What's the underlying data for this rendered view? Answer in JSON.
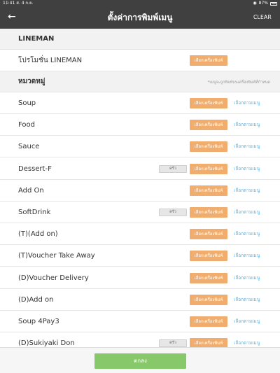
{
  "status_bar": {
    "time": "11:41",
    "date": "ส. 4 ก.ย.",
    "battery": "87%"
  },
  "nav": {
    "title": "ตั้งค่าการพิมพ์เมนู",
    "clear_label": "CLEAR"
  },
  "lineman_section": {
    "title": "LINEMAN",
    "item": {
      "label": "โปรโมชั่น LINEMAN",
      "printer_button": "เลือกเครื่องพิมพ์"
    }
  },
  "category_section": {
    "title": "หมวดหมู่",
    "note": "*เมนูจะถูกพิมพ์บนเครื่องพิมพ์ที่กำหนด"
  },
  "categories": [
    {
      "label": "Soup",
      "badge": "",
      "printer_button": "เลือกเครื่องพิมพ์",
      "menu_button": "เลือกตามเมนู"
    },
    {
      "label": "Food",
      "badge": "",
      "printer_button": "เลือกเครื่องพิมพ์",
      "menu_button": "เลือกตามเมนู"
    },
    {
      "label": "Sauce",
      "badge": "",
      "printer_button": "เลือกเครื่องพิมพ์",
      "menu_button": "เลือกตามเมนู"
    },
    {
      "label": "Dessert-F",
      "badge": "ครัว",
      "printer_button": "เลือกเครื่องพิมพ์",
      "menu_button": "เลือกตามเมนู"
    },
    {
      "label": "Add On",
      "badge": "",
      "printer_button": "เลือกเครื่องพิมพ์",
      "menu_button": "เลือกตามเมนู"
    },
    {
      "label": "SoftDrink",
      "badge": "ครัว",
      "printer_button": "เลือกเครื่องพิมพ์",
      "menu_button": "เลือกตามเมนู"
    },
    {
      "label": "(T)(Add on)",
      "badge": "",
      "printer_button": "เลือกเครื่องพิมพ์",
      "menu_button": "เลือกตามเมนู"
    },
    {
      "label": "(T)Voucher Take Away",
      "badge": "",
      "printer_button": "เลือกเครื่องพิมพ์",
      "menu_button": "เลือกตามเมนู"
    },
    {
      "label": "(D)Voucher Delivery",
      "badge": "",
      "printer_button": "เลือกเครื่องพิมพ์",
      "menu_button": "เลือกตามเมนู"
    },
    {
      "label": "(D)Add on",
      "badge": "",
      "printer_button": "เลือกเครื่องพิมพ์",
      "menu_button": "เลือกตามเมนู"
    },
    {
      "label": "Soup 4Pay3",
      "badge": "",
      "printer_button": "เลือกเครื่องพิมพ์",
      "menu_button": "เลือกตามเมนู"
    },
    {
      "label": "(D)Sukiyaki Don",
      "badge": "ครัว",
      "printer_button": "เลือกเครื่องพิมพ์",
      "menu_button": "เลือกตามเมนู"
    }
  ],
  "footer": {
    "ok_label": "ตกลง"
  },
  "colors": {
    "header": "#404040",
    "printer_button": "#f0ad6e",
    "menu_link": "#5ab3de",
    "ok_button": "#86c86a"
  }
}
